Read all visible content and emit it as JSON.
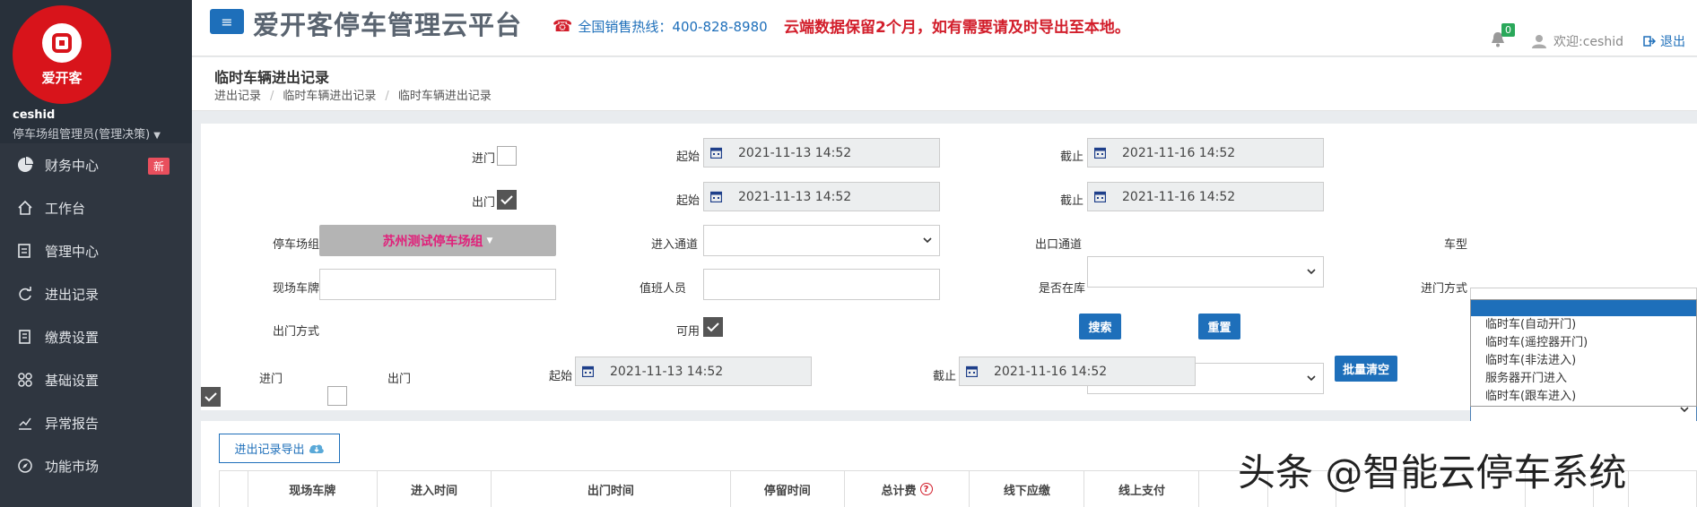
{
  "sidebar": {
    "logo_text": "爱开客",
    "user_name": "ceshid",
    "user_role": "停车场组管理员(管理决策)",
    "items": [
      {
        "label": "财务中心",
        "icon": "pie-chart-icon",
        "badge": "新"
      },
      {
        "label": "工作台",
        "icon": "home-icon"
      },
      {
        "label": "管理中心",
        "icon": "management-icon"
      },
      {
        "label": "进出记录",
        "icon": "refresh-icon"
      },
      {
        "label": "缴费设置",
        "icon": "payment-icon"
      },
      {
        "label": "基础设置",
        "icon": "grid-icon"
      },
      {
        "label": "异常报告",
        "icon": "report-chart-icon"
      },
      {
        "label": "功能市场",
        "icon": "compass-icon"
      }
    ]
  },
  "header": {
    "title": "爱开客停车管理云平台",
    "hotline": "全国销售热线：400-828-8980",
    "notice": "云端数据保留2个月，如有需要请及时导出至本地。",
    "notification_count": "0",
    "welcome": "欢迎:ceshid",
    "logout": "退出"
  },
  "page": {
    "title": "临时车辆进出记录",
    "breadcrumb": [
      "进出记录",
      "临时车辆进出记录",
      "临时车辆进出记录"
    ]
  },
  "filter": {
    "entry_label": "进门",
    "exit_label": "出门",
    "start_label": "起始",
    "end_label": "截止",
    "entry_start": "2021-11-13 14:52",
    "entry_end": "2021-11-16 14:52",
    "exit_start": "2021-11-13 14:52",
    "exit_end": "2021-11-16 14:52",
    "lot_group_label": "停车场组",
    "lot_group_value": "苏州测试停车场组",
    "in_channel_label": "进入通道",
    "out_channel_label": "出口通道",
    "car_type_label": "车型",
    "plate_label": "现场车牌",
    "duty_label": "值班人员",
    "in_lot_label": "是否在库",
    "entry_mode_label": "进门方式",
    "exit_mode_label": "出门方式",
    "available_label": "可用",
    "search_button": "搜索",
    "reset_button": "重置",
    "row3_start": "2021-11-13 14:52",
    "row3_end": "2021-11-16 14:52",
    "batch_clear_button": "批量清空"
  },
  "entry_mode_options": [
    "临时车(自动开门)",
    "临时车(遥控器开门)",
    "临时车(非法进入)",
    "服务器开门进入",
    "临时车(跟车进入)"
  ],
  "table": {
    "export_button": "进出记录导出",
    "columns": [
      "",
      "现场车牌",
      "进入时间",
      "出门时间",
      "停留时间",
      "总计费",
      "线下应缴",
      "线上支付",
      "",
      "",
      "",
      "",
      "",
      "",
      ""
    ]
  },
  "watermark": "头条 @智能云停车系统"
}
